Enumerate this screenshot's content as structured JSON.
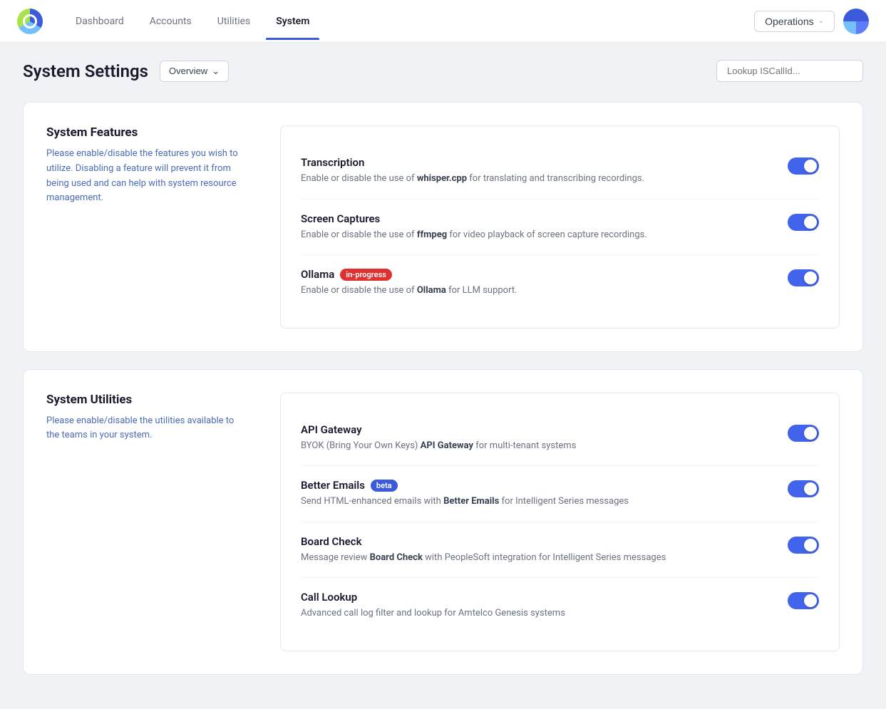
{
  "nav": {
    "links": [
      {
        "label": "Dashboard",
        "active": false
      },
      {
        "label": "Accounts",
        "active": false
      },
      {
        "label": "Utilities",
        "active": false
      },
      {
        "label": "System",
        "active": true
      }
    ],
    "operations_label": "Operations",
    "operations_chevron": "⌃"
  },
  "page": {
    "title": "System Settings",
    "overview_label": "Overview",
    "lookup_placeholder": "Lookup ISCallId..."
  },
  "system_features": {
    "section_title": "System Features",
    "section_desc": "Please enable/disable the features you wish to utilize. Disabling a feature will prevent it from being used and can help with system resource management.",
    "items": [
      {
        "name": "Transcription",
        "badge": null,
        "desc_prefix": "Enable or disable the use of ",
        "desc_bold": "whisper.cpp",
        "desc_suffix": " for translating and transcribing recordings.",
        "enabled": true
      },
      {
        "name": "Screen Captures",
        "badge": null,
        "desc_prefix": "Enable or disable the use of ",
        "desc_bold": "ffmpeg",
        "desc_suffix": " for video playback of screen capture recordings.",
        "enabled": true
      },
      {
        "name": "Ollama",
        "badge": "in-progress",
        "badge_class": "badge-in-progress",
        "desc_prefix": "Enable or disable the use of ",
        "desc_bold": "Ollama",
        "desc_suffix": " for LLM support.",
        "enabled": true
      }
    ]
  },
  "system_utilities": {
    "section_title": "System Utilities",
    "section_desc": "Please enable/disable the utilities available to the teams in your system.",
    "items": [
      {
        "name": "API Gateway",
        "badge": null,
        "desc_prefix": "BYOK (Bring Your Own Keys) ",
        "desc_bold": "API Gateway",
        "desc_suffix": " for multi-tenant systems",
        "enabled": true
      },
      {
        "name": "Better Emails",
        "badge": "beta",
        "badge_class": "badge-beta",
        "desc_prefix": "Send HTML-enhanced emails with ",
        "desc_bold": "Better Emails",
        "desc_suffix": " for Intelligent Series messages",
        "enabled": true
      },
      {
        "name": "Board Check",
        "badge": null,
        "desc_prefix": "Message review ",
        "desc_bold": "Board Check",
        "desc_suffix": " with PeopleSoft integration for Intelligent Series messages",
        "enabled": true
      },
      {
        "name": "Call Lookup",
        "badge": null,
        "desc_prefix": "Advanced call log filter and lookup for Amtelco Genesis systems",
        "desc_bold": "",
        "desc_suffix": "",
        "enabled": true
      }
    ]
  }
}
